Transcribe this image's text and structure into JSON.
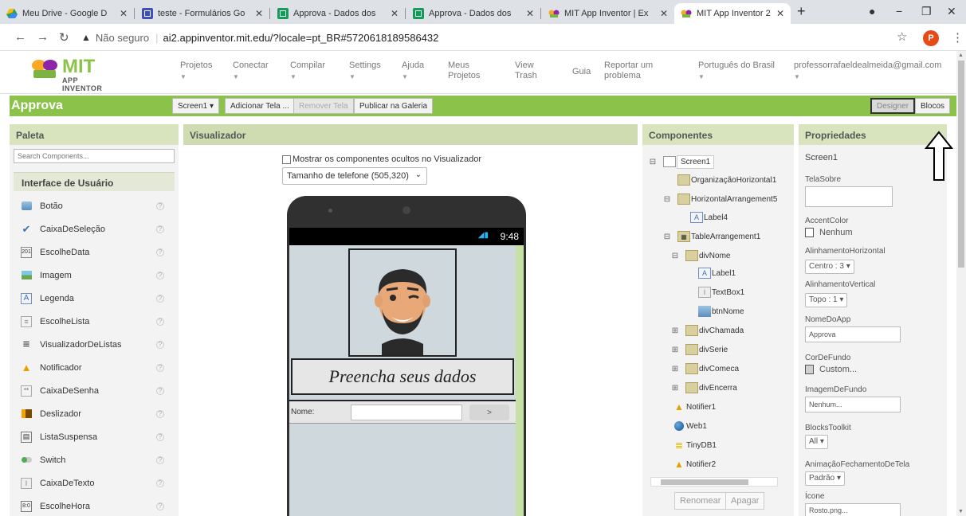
{
  "browser": {
    "tabs": [
      {
        "title": "Meu Drive - Google D",
        "color": "#1fa463"
      },
      {
        "title": "teste - Formulários Go",
        "color": "#3f51b5"
      },
      {
        "title": "Approva - Dados dos",
        "color": "#0f9d58"
      },
      {
        "title": "Approva - Dados dos",
        "color": "#0f9d58"
      },
      {
        "title": "MIT App Inventor | Ex",
        "color": "#f9a825"
      },
      {
        "title": "MIT App Inventor 2",
        "color": "#f9a825"
      }
    ],
    "insecure_label": "Não seguro",
    "url": "ai2.appinventor.mit.edu/?locale=pt_BR#5720618189586432",
    "profile_initial": "P"
  },
  "topnav": {
    "logo_title": "MIT",
    "logo_sub": "APP INVENTOR",
    "items": [
      "Projetos",
      "Conectar",
      "Compilar",
      "Settings",
      "Ajuda",
      "Meus Projetos",
      "View Trash",
      "Guia",
      "Reportar um problema",
      "Português do Brasil",
      "professorrafaeldealmeida@gmail.com"
    ]
  },
  "projectbar": {
    "name": "Approva",
    "screen_btn": "Screen1",
    "add_screen": "Adicionar Tela ...",
    "remove_screen": "Remover Tela",
    "publish": "Publicar na Galeria",
    "designer": "Designer",
    "blocks": "Blocos"
  },
  "palette": {
    "title": "Paleta",
    "search_placeholder": "Search Components...",
    "category": "Interface de Usuário",
    "items": [
      "Botão",
      "CaixaDeSeleção",
      "EscolheData",
      "Imagem",
      "Legenda",
      "EscolheLista",
      "VisualizadorDeListas",
      "Notificador",
      "CaixaDeSenha",
      "Deslizador",
      "ListaSuspensa",
      "Switch",
      "CaixaDeTexto",
      "EscolheHora"
    ],
    "help": "?"
  },
  "viewer": {
    "title": "Visualizador",
    "show_hidden": "Mostrar os componentes ocultos no Visualizador",
    "size_select": "Tamanho de telefone (505,320)",
    "phone_time": "9:48",
    "screen_title": "Preencha seus dados",
    "name_label": "Nome:",
    "go_button": ">"
  },
  "components": {
    "title": "Componentes",
    "tree": [
      "Screen1",
      "OrganizaçãoHorizontal1",
      "HorizontalArrangement5",
      "Label4",
      "TableArrangement1",
      "divNome",
      "Label1",
      "TextBox1",
      "btnNome",
      "divChamada",
      "divSerie",
      "divComeca",
      "divEncerra",
      "Notifier1",
      "Web1",
      "TinyDB1",
      "Notifier2"
    ],
    "rename": "Renomear",
    "delete": "Apagar"
  },
  "properties": {
    "title": "Propriedades",
    "screen": "Screen1",
    "tela_sobre": "TelaSobre",
    "accent_color": "AccentColor",
    "accent_value": "Nenhum",
    "align_h": "AlinhamentoHorizontal",
    "align_h_value": "Centro : 3",
    "align_v": "AlinhamentoVertical",
    "align_v_value": "Topo : 1",
    "app_name": "NomeDoApp",
    "app_name_value": "Approva",
    "bg_color": "CorDeFundo",
    "bg_color_value": "Custom...",
    "bg_image": "ImagemDeFundo",
    "bg_image_value": "Nenhum...",
    "toolkit": "BlocksToolkit",
    "toolkit_value": "All",
    "close_anim": "AnimaçãoFechamentoDeTela",
    "close_anim_value": "Padrão",
    "icon": "Ícone",
    "icon_value": "Rosto.png..."
  }
}
